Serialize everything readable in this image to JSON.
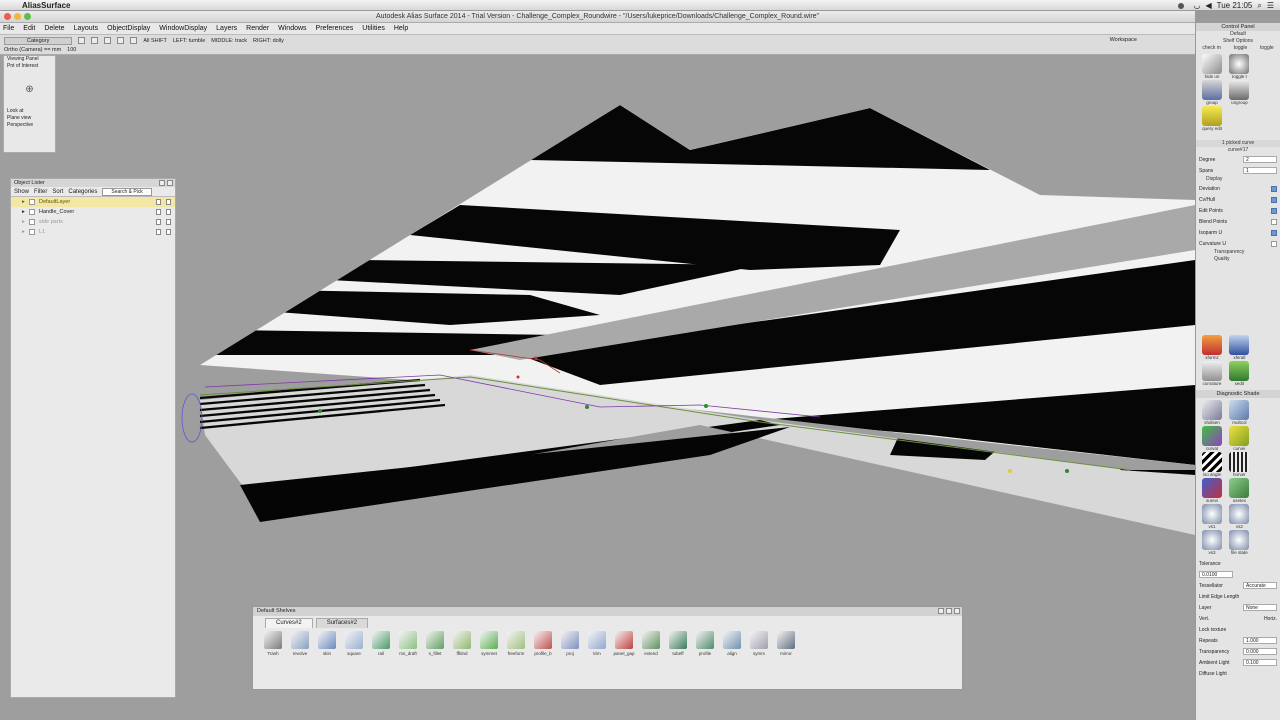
{
  "system": {
    "app_name": "AliasSurface",
    "clock": "Tue 21:05"
  },
  "window": {
    "title": "Autodesk Alias Surface 2014  -  Trial Version  -  Challenge_Complex_Roundwire  -  \"/Users/lukeprice/Downloads/Challenge_Complex_Round.wire\""
  },
  "menu": [
    "File",
    "Edit",
    "Delete",
    "Layouts",
    "ObjectDisplay",
    "WindowDisplay",
    "Layers",
    "Render",
    "Windows",
    "Preferences",
    "Utilities",
    "Help"
  ],
  "toolbar": {
    "category_label": "Category",
    "camera_label": "Ortho (Camera) == mm",
    "ortho_value": "100",
    "mouse_hints": [
      "All SHIFT",
      "LEFT: tumble",
      "MIDDLE: track",
      "RIGHT: dolly"
    ],
    "workspace_label": "Workspace"
  },
  "viewing_panel": {
    "title": "Viewing Panel",
    "poi": "Pnt of Interest",
    "look_at": "Look at",
    "plane_view": "Plane view",
    "perspective": "Perspective"
  },
  "object_lister": {
    "title": "Object Lister",
    "menus": [
      "Show",
      "Filter",
      "Sort",
      "Categories"
    ],
    "search_placeholder": "Search & Pick",
    "items": [
      {
        "label": "DefaultLayer",
        "state": "selected"
      },
      {
        "label": "Handle_Cover",
        "state": "normal"
      },
      {
        "label": "side parts",
        "state": "grey"
      },
      {
        "label": "L1",
        "state": "grey"
      }
    ]
  },
  "control_panel": {
    "title": "Control Panel",
    "preset": "Default",
    "shelf_options": "Shelf Options",
    "tabs": [
      "check m",
      "toggle",
      "toggle"
    ],
    "top_icons": [
      "hide un",
      "toggle t",
      "group",
      "ungroup",
      "query edit"
    ],
    "picked_label": "1 picked curve",
    "curve_name": "curve#17",
    "degree_label": "Degree",
    "degree_value": "2",
    "spans_label": "Spans",
    "spans_value": "1",
    "display_label": "Display",
    "display_rows": [
      {
        "label": "Deviation",
        "checked": true
      },
      {
        "label": "Cv/Hull",
        "checked": true
      },
      {
        "label": "Edit Points",
        "checked": true
      },
      {
        "label": "Blend Points",
        "checked": false
      },
      {
        "label": "Isoparm U",
        "checked": true
      },
      {
        "label": "Curvature U",
        "checked": false
      }
    ],
    "transparency_label": "Transparency",
    "quality_label": "Quality",
    "eval_icons": [
      "xformz",
      "xferall",
      "curvature",
      "xedit"
    ],
    "diag_title": "Diagnostic Shade",
    "diag_icons": [
      "shdisen",
      "multcol",
      "curvat",
      "curvei",
      "iso angle",
      "horver",
      "surevi",
      "usetex",
      "vs1",
      "vs2",
      "vs3",
      "file state"
    ],
    "tolerance_label": "Tolerance",
    "tolerance_value": "0.0100",
    "tessellator_label": "Tessellator",
    "tessellator_value": "Accurate",
    "limit_edge_label": "Limit Edge Length",
    "layer_label": "Layer",
    "layer_value": "None",
    "vert_label": "Vert.",
    "horiz_label": "Horiz.",
    "lock_texture": "Lock texture",
    "repeats_label": "Repeats",
    "repeats_value": "1.000",
    "transparency_value": "0.000",
    "ambient_label": "Ambient Light",
    "ambient_value": "0.100",
    "diffuse_label": "Diffuse Light"
  },
  "shelf": {
    "title": "Default Shelves",
    "tabs": [
      "Curves#2",
      "Surfaces#2"
    ],
    "tools": [
      "Trash",
      "revolve",
      "skin",
      "square",
      "rail",
      "ms_draft",
      "s_fillet",
      "ffblnd",
      "symmet",
      "freeform",
      "profile_b",
      "proj",
      "trim",
      "panel_gap",
      "extend",
      "tubeff",
      "profile",
      "align",
      "symm",
      "mirror"
    ]
  },
  "colors": {
    "viewport_bg": "#9e9e9e",
    "selected_layer": "#f2e7a5",
    "accent": "#6d98d6"
  }
}
